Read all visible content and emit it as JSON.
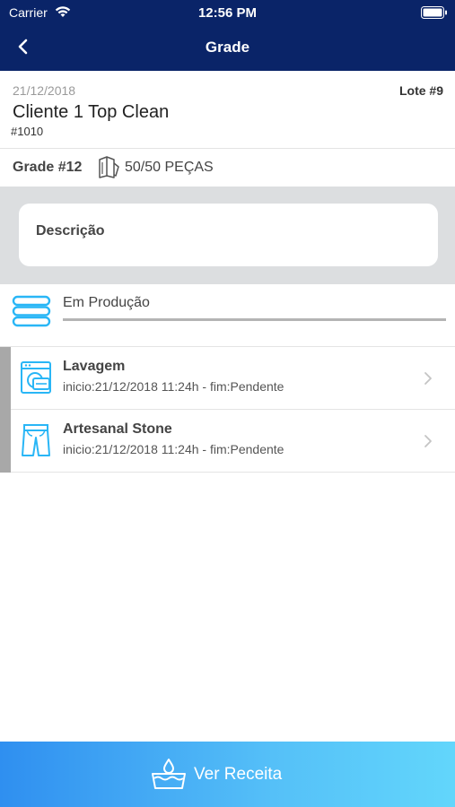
{
  "status_bar": {
    "carrier": "Carrier",
    "time": "12:56 PM"
  },
  "nav": {
    "title": "Grade",
    "back_icon": "chevron-left-icon"
  },
  "header": {
    "date": "21/12/2018",
    "lote": "Lote #9",
    "client": "Cliente 1 Top Clean",
    "client_id": "#1010"
  },
  "grade": {
    "label": "Grade #12",
    "pieces": "50/50 PEÇAS",
    "icon": "garment-tag-icon"
  },
  "description": {
    "label": "Descrição"
  },
  "production": {
    "label": "Em Produção",
    "icon": "stacked-towels-icon"
  },
  "steps": [
    {
      "title": "Lavagem",
      "subtitle": "inicio:21/12/2018 11:24h - fim:Pendente",
      "icon": "washing-machine-icon"
    },
    {
      "title": "Artesanal Stone",
      "subtitle": "inicio:21/12/2018 11:24h - fim:Pendente",
      "icon": "pants-icon"
    }
  ],
  "footer": {
    "button_label": "Ver Receita",
    "icon": "water-basin-icon"
  },
  "colors": {
    "nav_bg": "#0a2468",
    "accent": "#29b6f6",
    "footer_start": "#2f8ff0",
    "footer_end": "#62d6fb"
  }
}
